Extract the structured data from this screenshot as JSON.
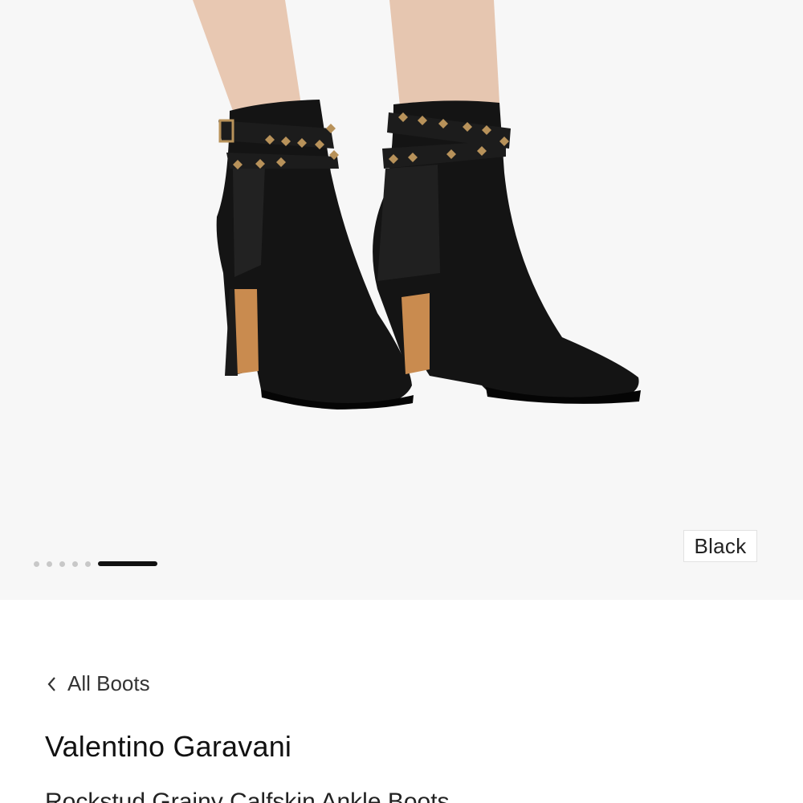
{
  "gallery": {
    "color_label": "Black",
    "image_count": 6,
    "active_index": 6
  },
  "breadcrumb": {
    "label": "All Boots"
  },
  "product": {
    "brand": "Valentino Garavani",
    "name": "Rockstud Grainy Calfskin Ankle Boots"
  },
  "icons": {
    "back": "chevron-left-icon"
  },
  "colors": {
    "gallery_bg": "#f7f7f7",
    "boot": "#111111",
    "heel": "#c98b4f",
    "stud": "#b8925a"
  }
}
